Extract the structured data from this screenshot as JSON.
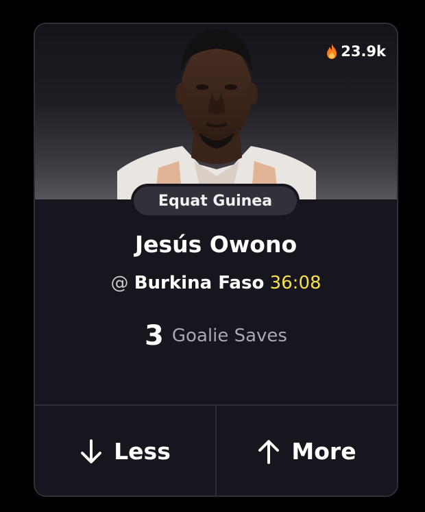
{
  "card": {
    "popularity": "23.9k",
    "team": "Equat Guinea",
    "player_name": "Jesús Owono",
    "matchup": {
      "at": "@",
      "opponent": "Burkina Faso",
      "clock": "36:08"
    },
    "stat": {
      "value": "3",
      "type": "Goalie Saves"
    },
    "actions": {
      "less_label": "Less",
      "more_label": "More"
    }
  },
  "colors": {
    "background": "#000000",
    "card": "#17161f",
    "border": "#2f2f38",
    "pill": "#323139",
    "clock": "#f5e24a",
    "fire": "#ff7a1a"
  },
  "icons": [
    "fire-icon",
    "arrow-down-icon",
    "arrow-up-icon"
  ]
}
